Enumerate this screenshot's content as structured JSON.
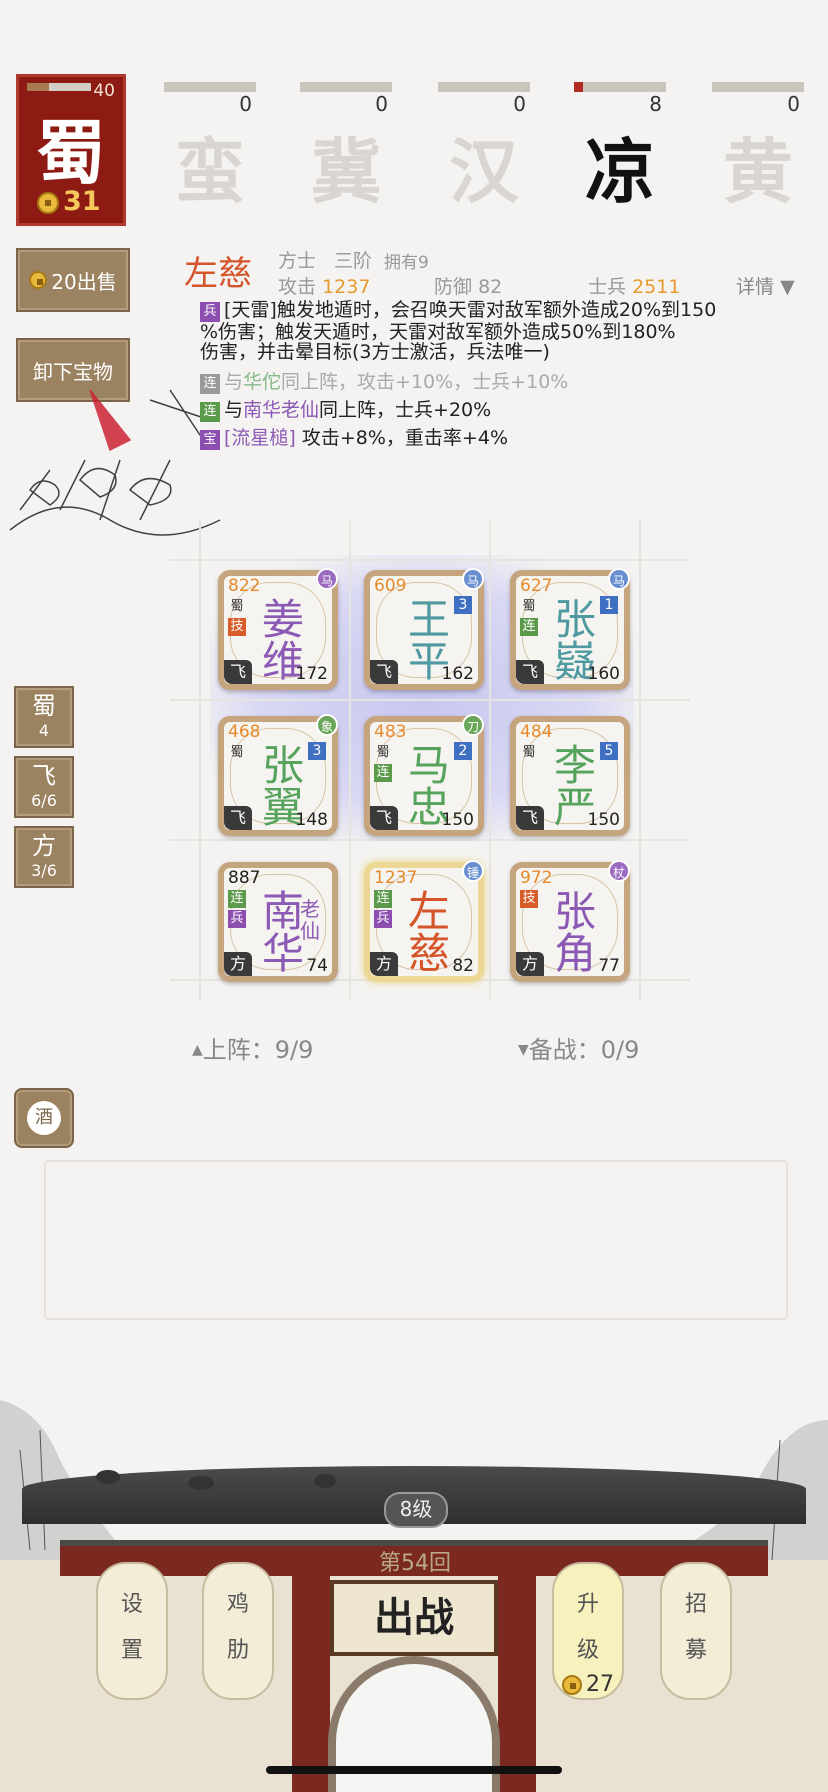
{
  "factions": {
    "main": {
      "char": "蜀",
      "count": "40",
      "coins": "31"
    },
    "others": [
      {
        "char": "蛮",
        "count": "0",
        "progress": 0
      },
      {
        "char": "冀",
        "count": "0",
        "progress": 0
      },
      {
        "char": "汉",
        "count": "0",
        "progress": 0
      },
      {
        "char": "凉",
        "count": "8",
        "progress": 0.1,
        "active": true
      },
      {
        "char": "黄",
        "count": "0",
        "progress": 0
      }
    ]
  },
  "left_buttons": {
    "sell": "20出售",
    "unequip": "卸下宝物"
  },
  "hero": {
    "name": "左慈",
    "class": "方士",
    "rank": "三阶",
    "owned": "拥有9",
    "attack_label": "攻击",
    "attack": "1237",
    "defense_label": "防御",
    "defense": "82",
    "soldier_label": "士兵",
    "soldier": "2511",
    "details": "详情",
    "skill_tag": "兵",
    "skill_lines": [
      "[天雷]触发地遁时，会召唤天雷对敌军额外造成20%到150",
      "%伤害；触发天遁时，天雷对敌军额外造成50%到180%",
      "伤害，并击晕目标(3方士激活，兵法唯一)"
    ],
    "link1_tag": "连",
    "link1_pre": "与",
    "link1_name": "华佗",
    "link1_post": "同上阵，攻击+10%，士兵+10%",
    "link2_tag": "连",
    "link2_pre": "与",
    "link2_name": "南华老仙",
    "link2_post": "同上阵，士兵+20%",
    "treasure_tag": "宝",
    "treasure_name": "[流星槌]",
    "treasure_effect": " 攻击+8%，重击率+4%"
  },
  "formation": [
    {
      "atk": "822",
      "n1": "姜",
      "n2": "维",
      "sol": "172",
      "type": "飞",
      "fac": "蜀",
      "tags": [
        "技"
      ],
      "badge": "马",
      "color": "#8c59b4"
    },
    {
      "atk": "609",
      "n1": "王",
      "n2": "平",
      "sol": "162",
      "type": "飞",
      "level": "3",
      "badge": "马",
      "color": "#4f9aa0"
    },
    {
      "atk": "627",
      "n1": "张",
      "n2": "嶷",
      "sol": "160",
      "type": "飞",
      "fac": "蜀",
      "tags": [
        "连"
      ],
      "level": "1",
      "badge": "马",
      "color": "#4f9aa0"
    },
    {
      "atk": "468",
      "n1": "张",
      "n2": "翼",
      "sol": "148",
      "type": "飞",
      "fac": "蜀",
      "level": "3",
      "badge": "象",
      "color": "#55a35c"
    },
    {
      "atk": "483",
      "n1": "马",
      "n2": "忠",
      "sol": "150",
      "type": "飞",
      "fac": "蜀",
      "tags": [
        "连"
      ],
      "level": "2",
      "badge": "刀",
      "color": "#55a35c"
    },
    {
      "atk": "484",
      "n1": "李",
      "n2": "严",
      "sol": "150",
      "type": "飞",
      "fac": "蜀",
      "level": "5",
      "color": "#55a35c"
    },
    {
      "atk": "887",
      "n1": "南",
      "n2": "华",
      "extra": "老仙",
      "sol": "74",
      "type": "方",
      "tags": [
        "连",
        "兵"
      ],
      "color": "#8c59b4",
      "atk_dark": true
    },
    {
      "atk": "1237",
      "n1": "左",
      "n2": "慈",
      "sol": "82",
      "type": "方",
      "tags": [
        "连",
        "兵"
      ],
      "badge": "锤",
      "color": "#d4552a",
      "selected": true
    },
    {
      "atk": "972",
      "n1": "张",
      "n2": "角",
      "sol": "77",
      "type": "方",
      "tags": [
        "技"
      ],
      "badge": "杖",
      "color": "#8c59b4"
    }
  ],
  "side_filters": [
    {
      "a": "蜀",
      "b": "4"
    },
    {
      "a": "飞",
      "b": "6/6"
    },
    {
      "a": "方",
      "b": "3/6"
    }
  ],
  "counters": {
    "deployed": "上阵：9/9",
    "reserve": "备战：0/9"
  },
  "wine_button": "酒",
  "gate": {
    "level": "8级",
    "round": "第54回",
    "battle": "出战",
    "settings": [
      "设",
      "置"
    ],
    "chicken": [
      "鸡",
      "肋"
    ],
    "upgrade": [
      "升",
      "级"
    ],
    "upgrade_cost": "27",
    "recruit": [
      "招",
      "募"
    ]
  }
}
